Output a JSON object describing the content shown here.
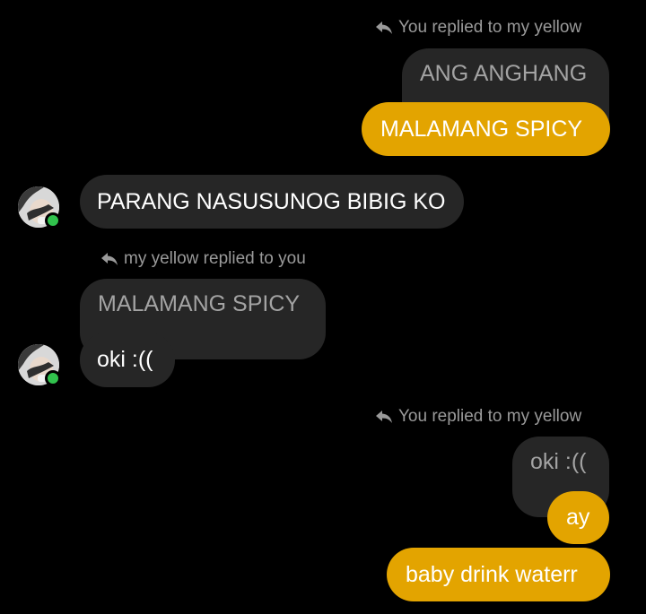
{
  "colors": {
    "background": "#000000",
    "incoming_bubble": "#262626",
    "outgoing_bubble": "#e3a400",
    "meta_text": "#9a9a9a",
    "quoted_text": "#a3a3a3",
    "online_dot": "#31c24d"
  },
  "messages": {
    "reply_note_1": "You replied to my yellow",
    "quoted_1": "ANG ANGHANG",
    "outgoing_1": "MALAMANG SPICY",
    "incoming_1": "PARANG NASUSUNOG BIBIG KO",
    "reply_note_2": "my yellow replied to you",
    "quoted_2": "MALAMANG SPICY",
    "incoming_2": "oki :((",
    "reply_note_3": "You replied to my yellow",
    "quoted_3": "oki :((",
    "outgoing_2": "ay",
    "outgoing_3": "baby drink waterr"
  },
  "icons": {
    "reply": "reply-arrow-icon",
    "avatar": "contact-avatar",
    "presence": "online-status-dot"
  }
}
